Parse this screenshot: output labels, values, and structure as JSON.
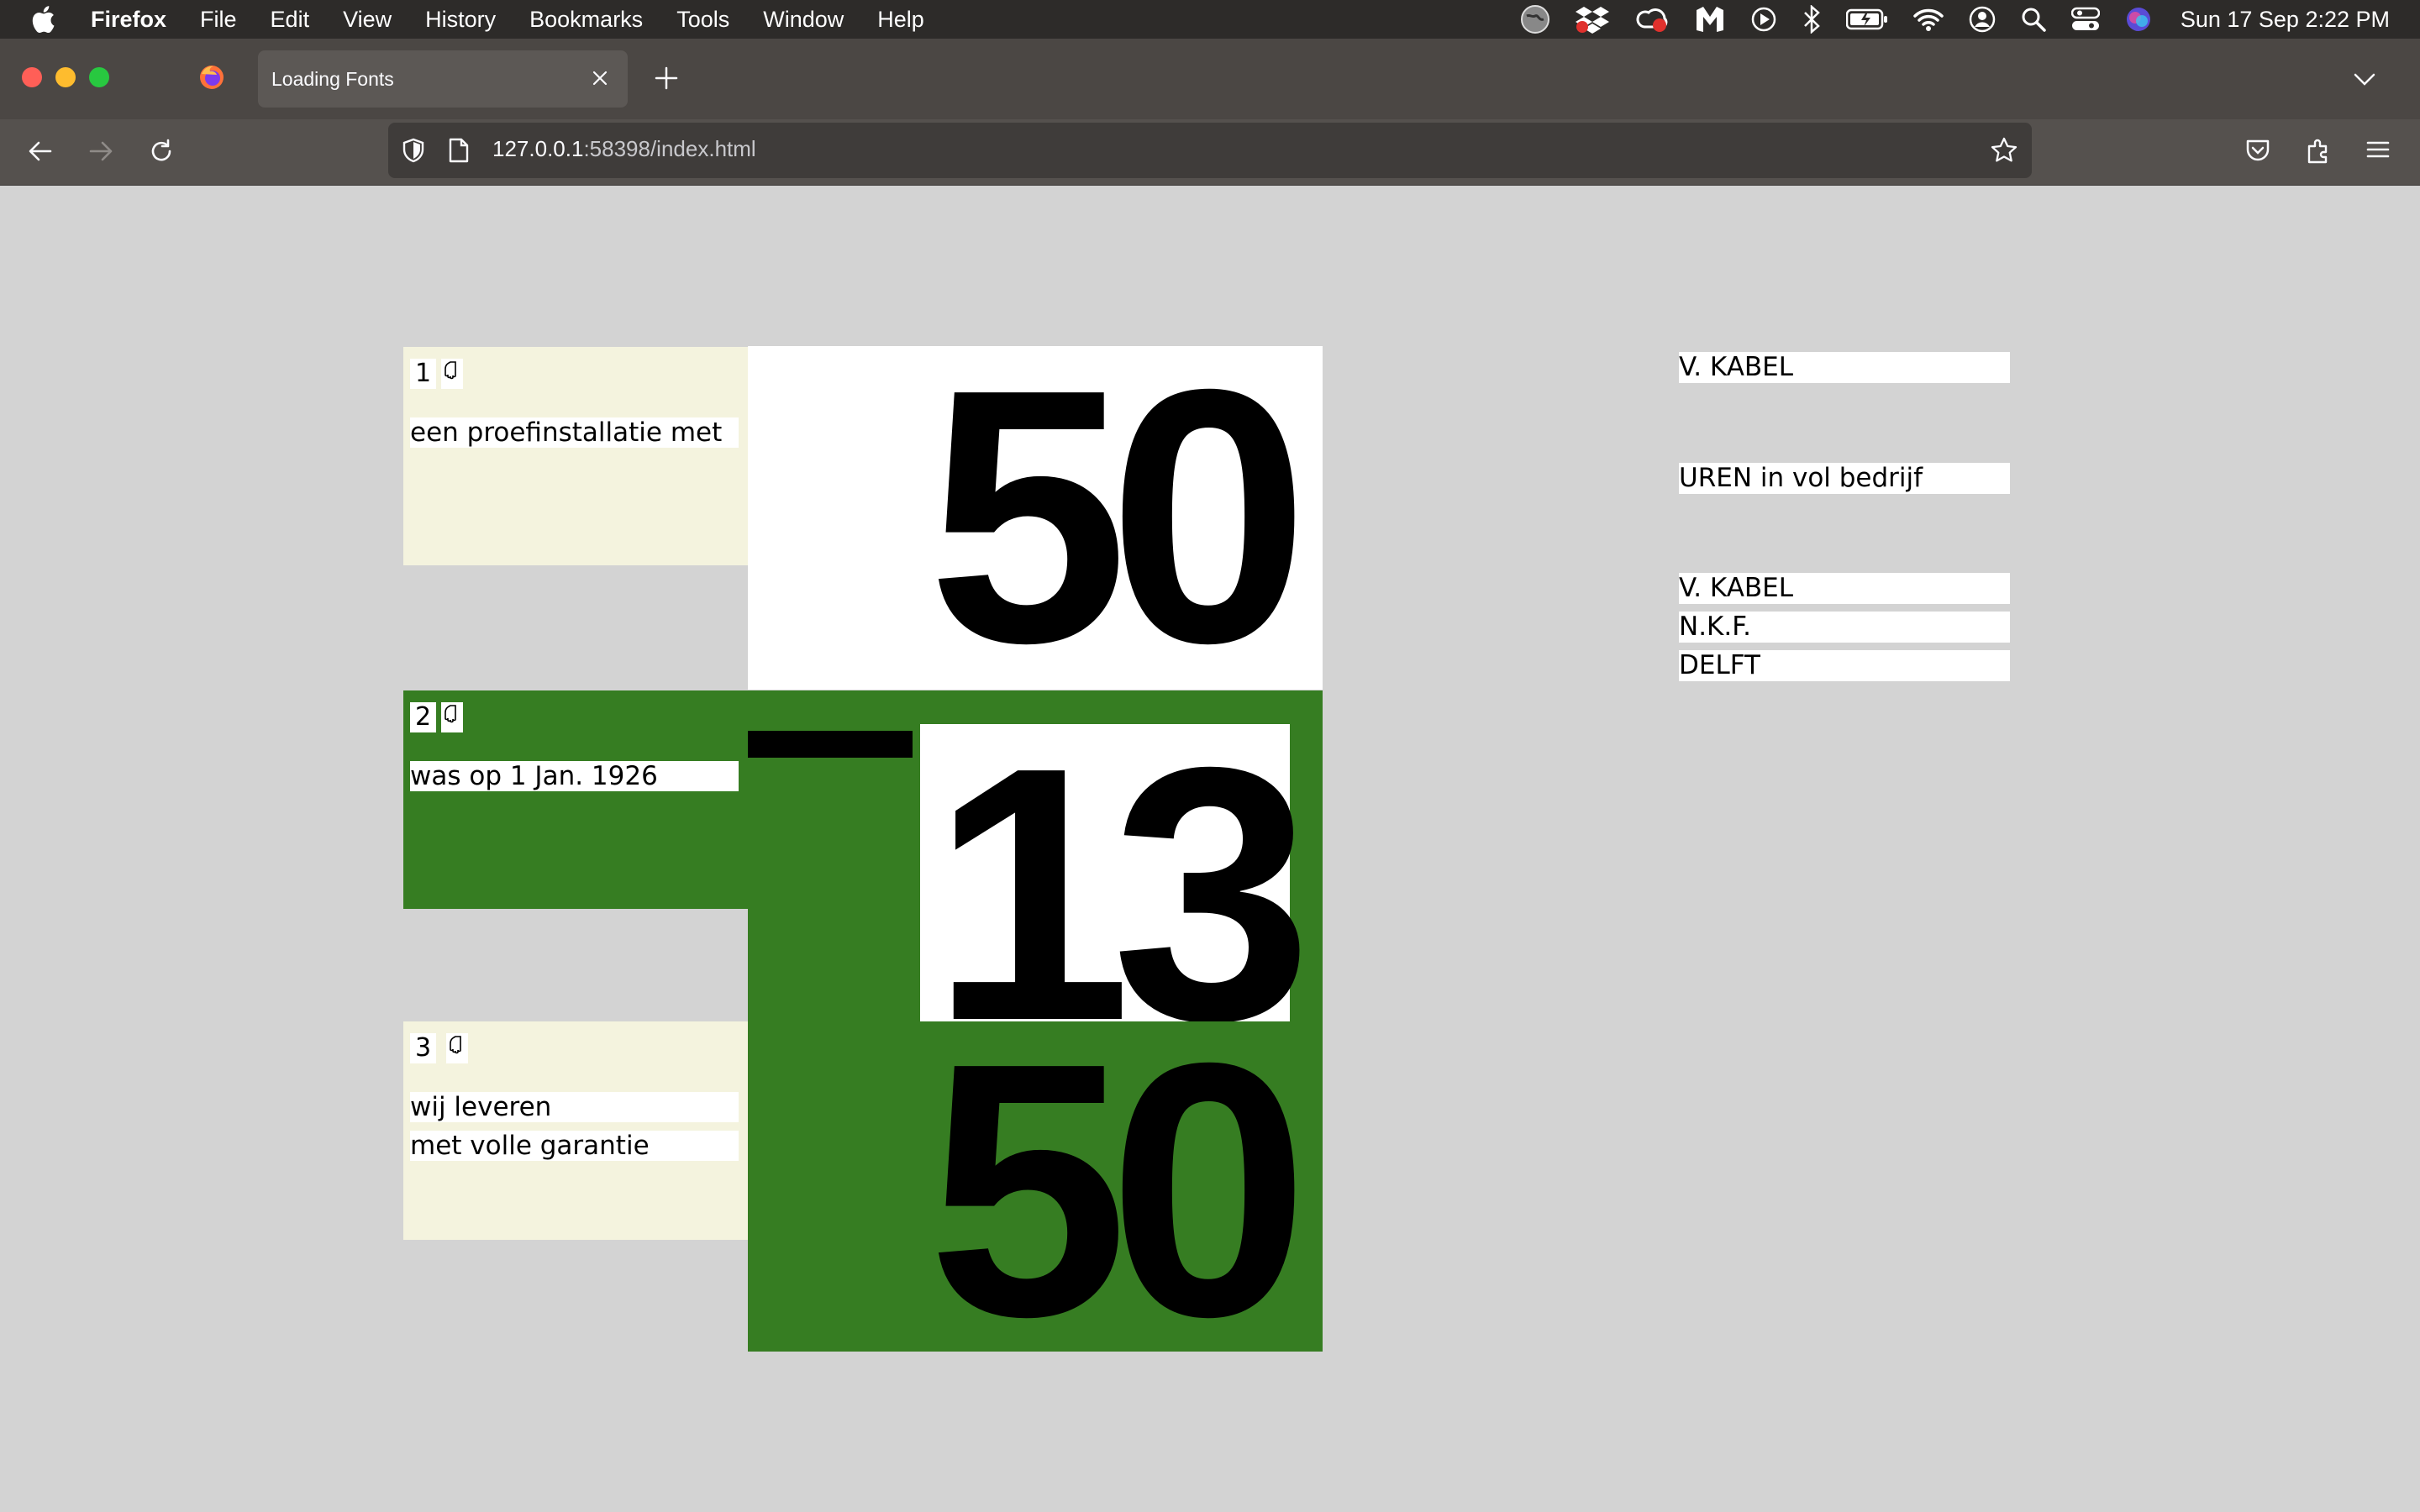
{
  "menubar": {
    "app_name": "Firefox",
    "items": [
      "File",
      "Edit",
      "View",
      "History",
      "Bookmarks",
      "Tools",
      "Window",
      "Help"
    ],
    "clock": "Sun 17 Sep  2:22 PM"
  },
  "browser": {
    "tab_title": "Loading Fonts",
    "url_host": "127.0.0.1",
    "url_rest": ":58398/index.html"
  },
  "colors": {
    "cream": "#f4f3de",
    "green": "#367d22",
    "white": "#ffffff",
    "page_bg": "#d3d3d3"
  },
  "rows": [
    {
      "number": "1",
      "lines": [
        "een proefinstallatie met"
      ],
      "big_number": "50"
    },
    {
      "number": "2",
      "lines": [
        "was op 1 Jan. 1926"
      ],
      "big_number": "13"
    },
    {
      "number": "3",
      "lines": [
        "wij leveren",
        "met volle garantie"
      ],
      "big_number": "50"
    }
  ],
  "side": {
    "label_1": "V. KABEL",
    "label_2": "UREN in vol bedrijf",
    "label_3": "V. KABEL",
    "label_4": "N.K.F.",
    "label_5": "DELFT"
  }
}
